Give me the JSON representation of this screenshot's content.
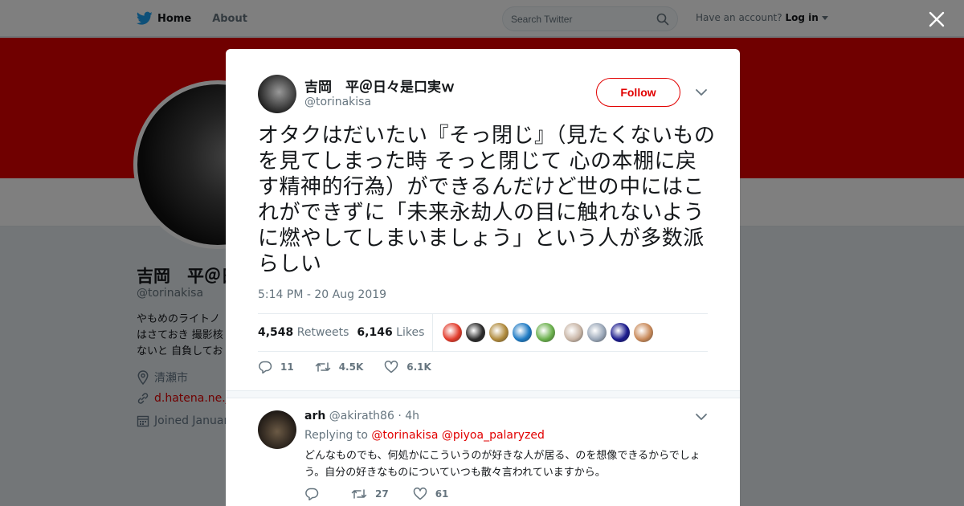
{
  "topbar": {
    "home_label": "Home",
    "about_label": "About",
    "search_placeholder": "Search Twitter",
    "account_prompt": "Have an account?",
    "login_label": "Log in"
  },
  "profile": {
    "name": "吉岡　平＠日",
    "handle": "@torinakisa",
    "bio_lines": [
      "やもめのライトノ",
      "はさておき 撮影核",
      "ないと 自負してお"
    ],
    "location": "清瀬市",
    "website": "d.hatena.ne.jp",
    "joined": "Joined Januar",
    "banner_color": "#e10000"
  },
  "tweet": {
    "author_name": "吉岡　平＠日々是口実ｗ",
    "author_handle": "@torinakisa",
    "follow_label": "Follow",
    "text": "オタクはだいたい『そっ閉じ』（見たくないものを見てしまった時 そっと閉じて 心の本棚に戻す精神的行為）ができるんだけど世の中にはこれができずに「未来永劫人の目に触れないように燃やしてしまいましょう」という人が多数派らしい",
    "timestamp": "5:14 PM - 20 Aug 2019",
    "retweets_count": "4,548",
    "retweets_label": "Retweets",
    "likes_count": "6,146",
    "likes_label": "Likes",
    "replies_short": "11",
    "retweets_short": "4.5K",
    "likes_short": "6.1K",
    "liker_colors": [
      "#e23c2c",
      "#2b2b2b",
      "#b08a3c",
      "#1f7bc4",
      "#6ab04c",
      "#c9b6a7",
      "#9aa7b8",
      "#1a1a8c",
      "#c98a5a"
    ]
  },
  "reply": {
    "name": "arh",
    "handle": "@akirath86",
    "time": "· 4h",
    "replying_prefix": "Replying to",
    "mention1": "@torinakisa",
    "mention2": "@piyoa_palaryzed",
    "text": "どんなものでも、何処かにこういうのが好きな人が居る、のを想像できるからでしょう。自分の好きなものについていつも散々言われていますから。",
    "replies": "",
    "retweets": "27",
    "likes": "61"
  },
  "accent_color": "#e10000",
  "twitter_blue": "#1da1f2"
}
